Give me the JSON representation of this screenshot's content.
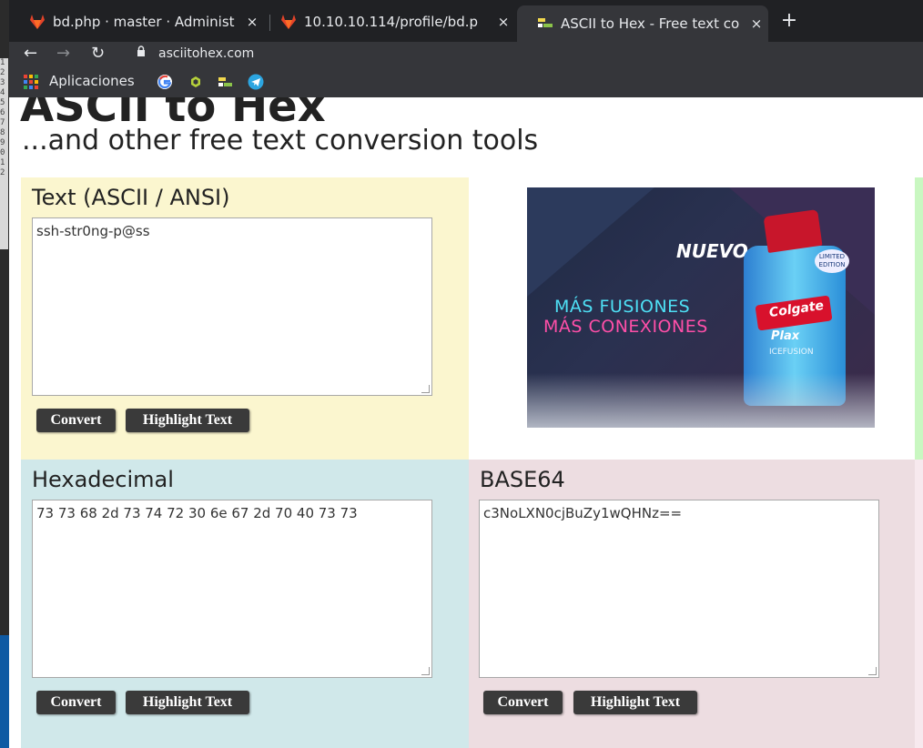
{
  "browser": {
    "tabs": [
      {
        "title": "bd.php · master · Administ",
        "favicon": "gitlab-icon",
        "active": false
      },
      {
        "title": "10.10.10.114/profile/bd.p",
        "favicon": "gitlab-icon",
        "active": false
      },
      {
        "title": "ASCII to Hex - Free text co",
        "favicon": "asciitohex-icon",
        "active": true
      }
    ],
    "close_glyph": "×",
    "new_tab_glyph": "+",
    "url": "asciitohex.com",
    "bookmarks": {
      "apps_label": "Aplicaciones",
      "items": [
        "google-icon",
        "extension-icon",
        "asciitohex-icon",
        "telegram-icon"
      ]
    }
  },
  "page": {
    "title": "ASCII to Hex",
    "subtitle": "...and other free text conversion tools",
    "text_panel": {
      "heading": "Text (ASCII / ANSI)",
      "value": "ssh-str0ng-p@ss",
      "convert_label": "Convert",
      "highlight_label": "Highlight Text"
    },
    "hex_panel": {
      "heading": "Hexadecimal",
      "value": "73 73 68 2d 73 74 72 30 6e 67 2d 70 40 73 73",
      "convert_label": "Convert",
      "highlight_label": "Highlight Text"
    },
    "base64_panel": {
      "heading": "BASE64",
      "value": "c3NoLXN0cjBuZy1wQHNz==",
      "convert_label": "Convert",
      "highlight_label": "Highlight Text"
    },
    "ad": {
      "nuevo": "NUEVO",
      "line1": "MÁS FUSIONES",
      "line2": "MÁS CONEXIONES",
      "brand": "Colgate",
      "product": "Plax",
      "variant": "ICEFUSION",
      "badge": "LIMITED EDITION",
      "info_glyph": "i"
    },
    "colors": {
      "text_panel_bg": "#fbf6cf",
      "hex_panel_bg": "#d0e8ea",
      "base64_panel_bg": "#eddde1",
      "button_bg": "#3a3a3a"
    }
  },
  "desktop": {
    "line_numbers": [
      "1",
      "2",
      "3",
      "4",
      "5",
      "6",
      "7",
      "8",
      "9",
      "0",
      "1",
      "2"
    ]
  }
}
